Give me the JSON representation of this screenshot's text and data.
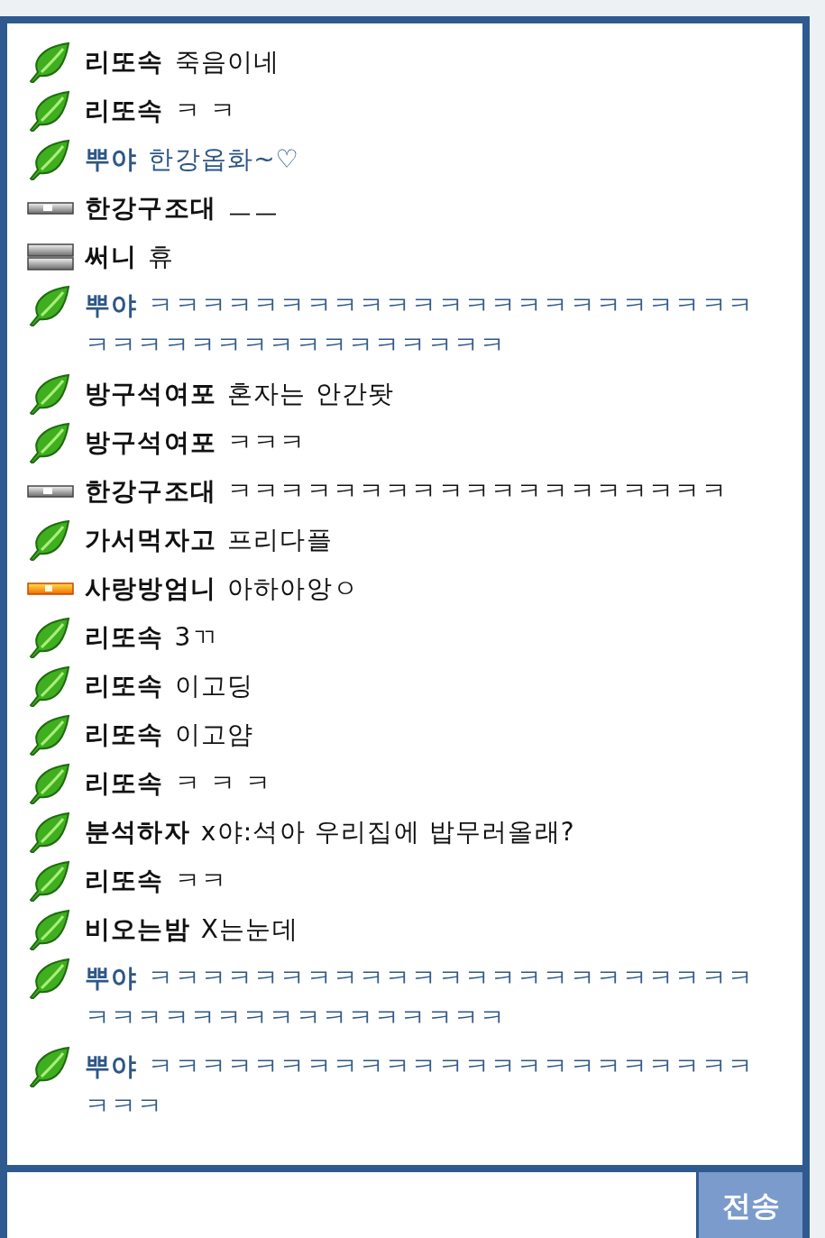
{
  "messages": [
    {
      "kind": "leaf",
      "name": "리또속",
      "text": "죽음이네",
      "color": "#111111"
    },
    {
      "kind": "leaf",
      "name": "리또속",
      "text": "ㅋ ㅋ",
      "color": "#111111"
    },
    {
      "kind": "leaf",
      "name": "뿌야",
      "text": "한강옵화~♡",
      "color": "#2d5786"
    },
    {
      "kind": "gray-bar",
      "name": "한강구조대",
      "text": "ㅡㅡ",
      "color": "#111111"
    },
    {
      "kind": "gray-stack",
      "name": "써니",
      "text": "휴",
      "color": "#111111"
    },
    {
      "kind": "leaf",
      "name": "뿌야",
      "text": "ㅋㅋㅋㅋㅋㅋㅋㅋㅋㅋㅋㅋㅋㅋㅋㅋㅋㅋㅋㅋㅋㅋㅋㅋㅋㅋㅋㅋㅋㅋㅋㅋㅋㅋㅋㅋㅋㅋㅋ",
      "color": "#2d5786"
    },
    {
      "kind": "leaf",
      "name": "방구석여포",
      "text": "혼자는 안간돳",
      "color": "#111111"
    },
    {
      "kind": "leaf",
      "name": "방구석여포",
      "text": "ㅋㅋㅋ",
      "color": "#111111"
    },
    {
      "kind": "gray-bar",
      "name": "한강구조대",
      "text": "ㅋㅋㅋㅋㅋㅋㅋㅋㅋㅋㅋㅋㅋㅋㅋㅋㅋㅋㅋ",
      "color": "#111111"
    },
    {
      "kind": "leaf",
      "name": "가서먹자고",
      "text": "프리다플",
      "color": "#111111"
    },
    {
      "kind": "orange-bar",
      "name": "사랑방엄니",
      "text": "아하아앙ㅇ",
      "color": "#111111"
    },
    {
      "kind": "leaf",
      "name": "리또속",
      "text": "3ㄲ",
      "color": "#111111"
    },
    {
      "kind": "leaf",
      "name": "리또속",
      "text": "이고딩",
      "color": "#111111"
    },
    {
      "kind": "leaf",
      "name": "리또속",
      "text": "이고얌",
      "color": "#111111"
    },
    {
      "kind": "leaf",
      "name": "리또속",
      "text": "ㅋ ㅋ ㅋ",
      "color": "#111111"
    },
    {
      "kind": "leaf",
      "name": "분석하자",
      "text": "x야:석아 우리집에 밥무러올래?",
      "color": "#111111"
    },
    {
      "kind": "leaf",
      "name": "리또속",
      "text": "ㅋㅋ",
      "color": "#111111"
    },
    {
      "kind": "leaf",
      "name": "비오는밤",
      "text": "X는눈데",
      "color": "#111111"
    },
    {
      "kind": "leaf",
      "name": "뿌야",
      "text": "ㅋㅋㅋㅋㅋㅋㅋㅋㅋㅋㅋㅋㅋㅋㅋㅋㅋㅋㅋㅋㅋㅋㅋㅋㅋㅋㅋㅋㅋㅋㅋㅋㅋㅋㅋㅋㅋㅋㅋ",
      "color": "#2d5786"
    },
    {
      "kind": "leaf",
      "name": "뿌야",
      "text": "ㅋㅋㅋㅋㅋㅋㅋㅋㅋㅋㅋㅋㅋㅋㅋㅋㅋㅋㅋㅋㅋㅋㅋㅋㅋㅋ",
      "color": "#2d5786"
    }
  ],
  "send_button": "전송"
}
